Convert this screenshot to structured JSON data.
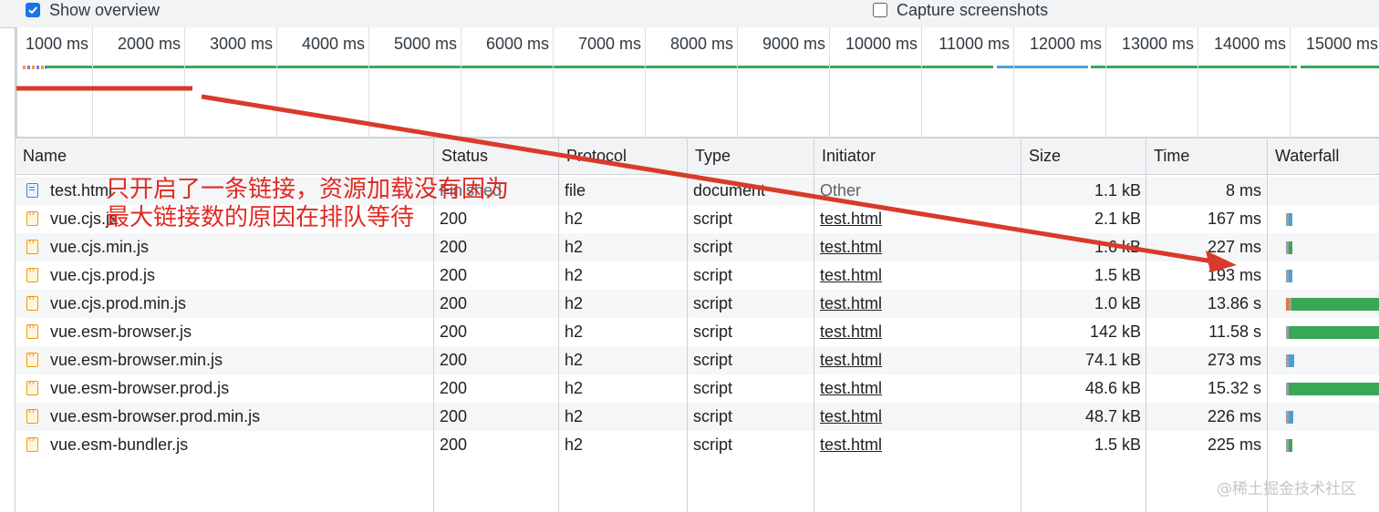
{
  "options": {
    "show_overview": {
      "label": "Show overview",
      "checked": true
    },
    "capture_screenshots": {
      "label": "Capture screenshots",
      "checked": false
    }
  },
  "overview": {
    "ticks": [
      "1000 ms",
      "2000 ms",
      "3000 ms",
      "4000 ms",
      "5000 ms",
      "6000 ms",
      "7000 ms",
      "8000 ms",
      "9000 ms",
      "10000 ms",
      "11000 ms",
      "12000 ms",
      "13000 ms",
      "14000 ms",
      "15000 ms"
    ]
  },
  "table": {
    "headers": {
      "name": "Name",
      "status": "Status",
      "protocol": "Protocol",
      "type": "Type",
      "initiator": "Initiator",
      "size": "Size",
      "time": "Time",
      "waterfall": "Waterfall"
    },
    "rows": [
      {
        "name": "test.html",
        "status": "Finished",
        "protocol": "file",
        "type": "document",
        "initiator": "Other",
        "size": "1.1 kB",
        "time": "8 ms",
        "icon": "html-document-icon"
      },
      {
        "name": "vue.cjs.js",
        "status": "200",
        "protocol": "h2",
        "type": "script",
        "initiator": "test.html",
        "size": "2.1 kB",
        "time": "167 ms",
        "icon": "script-file-icon"
      },
      {
        "name": "vue.cjs.min.js",
        "status": "200",
        "protocol": "h2",
        "type": "script",
        "initiator": "test.html",
        "size": "1.6 kB",
        "time": "227 ms",
        "icon": "script-file-icon"
      },
      {
        "name": "vue.cjs.prod.js",
        "status": "200",
        "protocol": "h2",
        "type": "script",
        "initiator": "test.html",
        "size": "1.5 kB",
        "time": "193 ms",
        "icon": "script-file-icon"
      },
      {
        "name": "vue.cjs.prod.min.js",
        "status": "200",
        "protocol": "h2",
        "type": "script",
        "initiator": "test.html",
        "size": "1.0 kB",
        "time": "13.86 s",
        "icon": "script-file-icon"
      },
      {
        "name": "vue.esm-browser.js",
        "status": "200",
        "protocol": "h2",
        "type": "script",
        "initiator": "test.html",
        "size": "142 kB",
        "time": "11.58 s",
        "icon": "script-file-icon"
      },
      {
        "name": "vue.esm-browser.min.js",
        "status": "200",
        "protocol": "h2",
        "type": "script",
        "initiator": "test.html",
        "size": "74.1 kB",
        "time": "273 ms",
        "icon": "script-file-icon"
      },
      {
        "name": "vue.esm-browser.prod.js",
        "status": "200",
        "protocol": "h2",
        "type": "script",
        "initiator": "test.html",
        "size": "48.6 kB",
        "time": "15.32 s",
        "icon": "script-file-icon"
      },
      {
        "name": "vue.esm-browser.prod.min.js",
        "status": "200",
        "protocol": "h2",
        "type": "script",
        "initiator": "test.html",
        "size": "48.7 kB",
        "time": "226 ms",
        "icon": "script-file-icon"
      },
      {
        "name": "vue.esm-bundler.js",
        "status": "200",
        "protocol": "h2",
        "type": "script",
        "initiator": "test.html",
        "size": "1.5 kB",
        "time": "225 ms",
        "icon": "script-file-icon"
      }
    ]
  },
  "annotation": {
    "line1": "只开启了一条链接，资源加载没有因为",
    "line2": "最大链接数的原因在排队等待",
    "color": "#e02a23"
  },
  "watermark": "@稀土掘金技术社区",
  "colors": {
    "accent": "#1a73e8",
    "waterfall_green": "#3aa757",
    "waterfall_blue": "#4a9fd8",
    "waterfall_gray": "#9aa0a6"
  }
}
